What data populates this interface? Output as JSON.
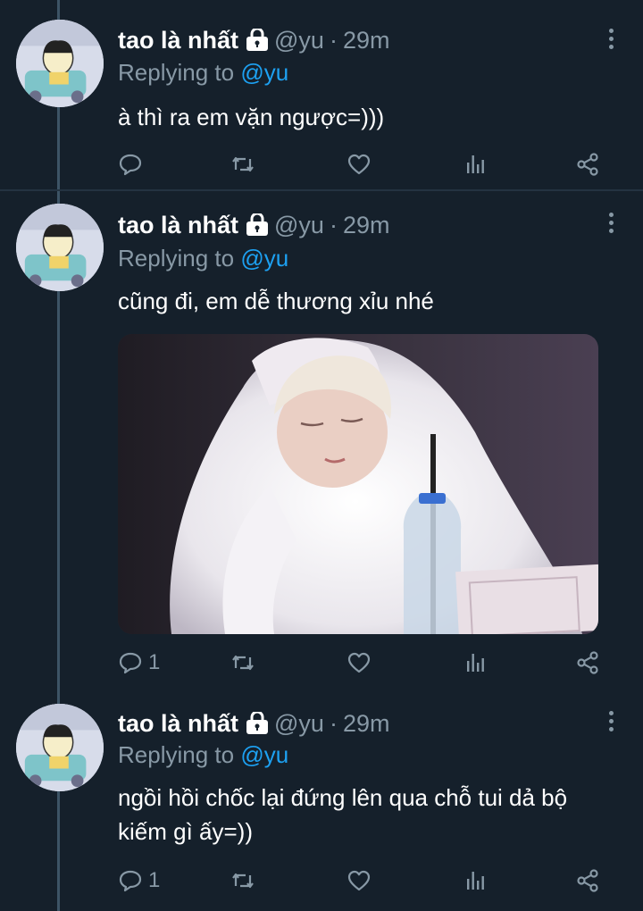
{
  "tweets": [
    {
      "name": "tao là nhất",
      "handle": "@yu",
      "separator": "·",
      "time": "29m",
      "replying_prefix": "Replying to",
      "replying_to": "@yu",
      "text": "à thì ra em vặn ngược=)))",
      "reply_count": "",
      "has_media": false
    },
    {
      "name": "tao là nhất",
      "handle": "@yu",
      "separator": "·",
      "time": "29m",
      "replying_prefix": "Replying to",
      "replying_to": "@yu",
      "text": "cũng đi, em dễ thương xỉu nhé",
      "reply_count": "1",
      "has_media": true
    },
    {
      "name": "tao là nhất",
      "handle": "@yu",
      "separator": "·",
      "time": "29m",
      "replying_prefix": "Replying to",
      "replying_to": "@yu",
      "text": "ngồi hồi chốc lại đứng lên qua chỗ tui dả bộ kiếm gì ấy=))",
      "reply_count": "1",
      "has_media": false
    }
  ],
  "icons": {
    "lock": "lock-icon",
    "more": "more-vertical-icon",
    "reply": "reply-icon",
    "retweet": "retweet-icon",
    "like": "heart-icon",
    "stats": "analytics-icon",
    "share": "share-icon"
  },
  "colors": {
    "background": "#15202b",
    "secondary_text": "#8899a6",
    "accent": "#1da1f2",
    "divider": "#243341"
  }
}
